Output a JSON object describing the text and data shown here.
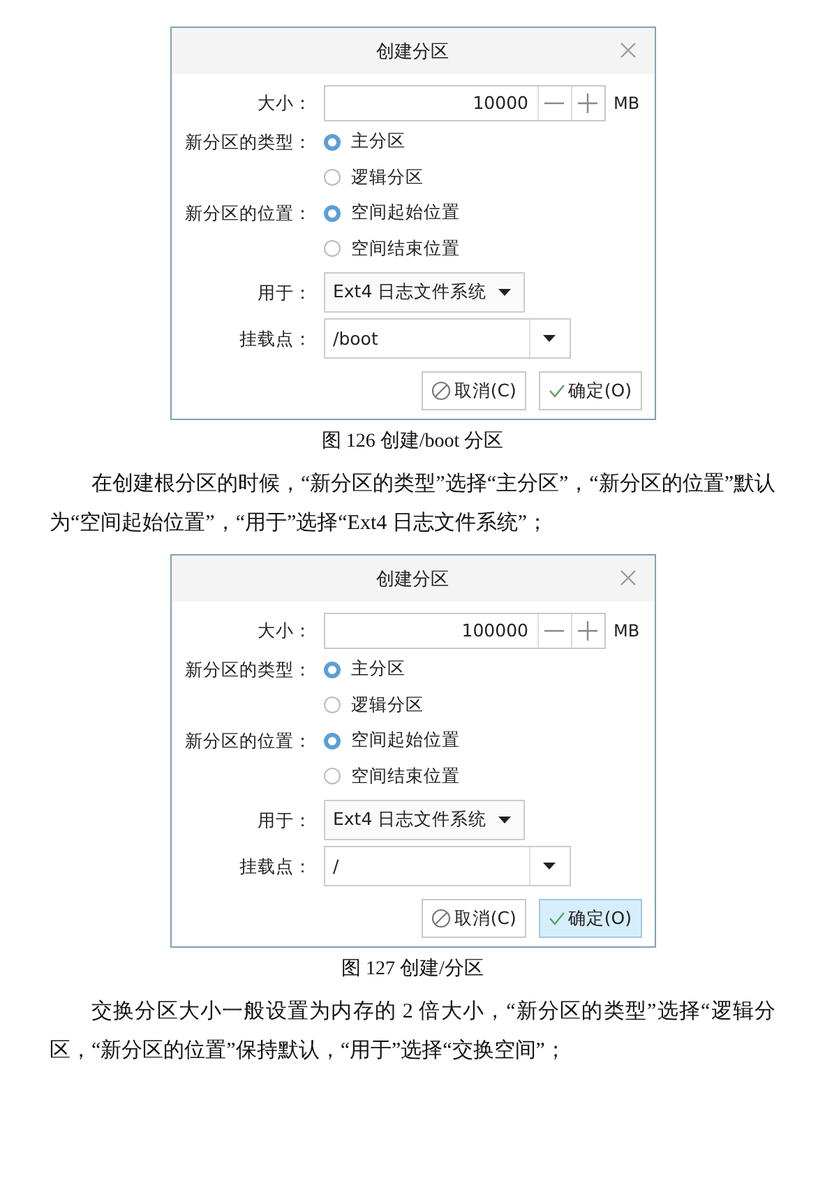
{
  "blocks": [
    {
      "kind": "dialog",
      "title": "创建分区",
      "size": {
        "label": "大小：",
        "value": "10000",
        "unit": "MB"
      },
      "radio_groups": [
        {
          "label": "新分区的类型：",
          "options": [
            {
              "label": "主分区",
              "selected": true
            },
            {
              "label": "逻辑分区",
              "selected": false
            }
          ]
        },
        {
          "label": "新分区的位置：",
          "options": [
            {
              "label": "空间起始位置",
              "selected": true
            },
            {
              "label": "空间结束位置",
              "selected": false
            }
          ]
        }
      ],
      "used_for": {
        "label": "用于：",
        "value": "Ext4 日志文件系统"
      },
      "mount_point": {
        "label": "挂载点：",
        "value": "/boot"
      },
      "buttons": [
        {
          "kind": "cancel",
          "label": "取消(C)",
          "highlighted": false
        },
        {
          "kind": "ok",
          "label": "确定(O)",
          "highlighted": false
        }
      ]
    },
    {
      "kind": "caption",
      "text": "图  126  创建/boot 分区"
    },
    {
      "kind": "paragraph",
      "text": "在创建根分区的时候，“新分区的类型”选择“主分区”，“新分区的位置”默认为“空间起始位置”，“用于”选择“Ext4 日志文件系统”；"
    },
    {
      "kind": "dialog",
      "title": "创建分区",
      "size": {
        "label": "大小：",
        "value": "100000",
        "unit": "MB"
      },
      "radio_groups": [
        {
          "label": "新分区的类型：",
          "options": [
            {
              "label": "主分区",
              "selected": true
            },
            {
              "label": "逻辑分区",
              "selected": false
            }
          ]
        },
        {
          "label": "新分区的位置：",
          "options": [
            {
              "label": "空间起始位置",
              "selected": true
            },
            {
              "label": "空间结束位置",
              "selected": false
            }
          ]
        }
      ],
      "used_for": {
        "label": "用于：",
        "value": "Ext4 日志文件系统"
      },
      "mount_point": {
        "label": "挂载点：",
        "value": "/"
      },
      "buttons": [
        {
          "kind": "cancel",
          "label": "取消(C)",
          "highlighted": false
        },
        {
          "kind": "ok",
          "label": "确定(O)",
          "highlighted": true
        }
      ]
    },
    {
      "kind": "caption",
      "text": "图  127  创建/分区"
    },
    {
      "kind": "paragraph",
      "text": "交换分区大小一般设置为内存的 2 倍大小，“新分区的类型”选择“逻辑分区，“新分区的位置”保持默认，“用于”选择“交换空间”；"
    }
  ]
}
